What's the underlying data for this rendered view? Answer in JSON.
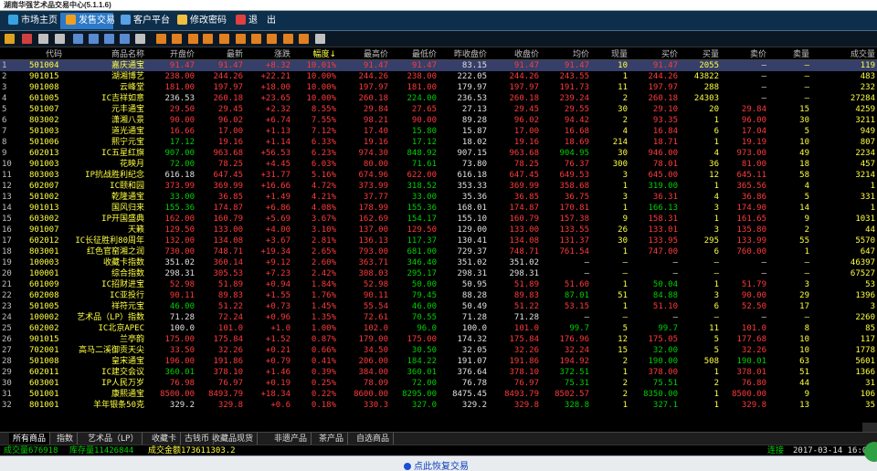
{
  "title": "湖南华强艺术品交易中心(5.1.1.6)",
  "menu": [
    {
      "label": "市场主页",
      "icon": "home-icon"
    },
    {
      "label": "发售交易",
      "icon": "trade-icon"
    },
    {
      "label": "客户平台",
      "icon": "user-icon"
    },
    {
      "label": "修改密码",
      "icon": "key-icon"
    },
    {
      "label": "退",
      "icon": "exit-icon"
    },
    {
      "label": "出",
      "icon": ""
    }
  ],
  "headers": [
    "",
    "代码",
    "商品名称",
    "开盘价",
    "最新",
    "涨跌",
    "幅度↓",
    "最高价",
    "最低价",
    "昨收盘价",
    "收盘价",
    "均价",
    "现量",
    "买价",
    "买量",
    "卖价",
    "卖量",
    "成交量"
  ],
  "rows": [
    [
      "1",
      "501004",
      "嘉庆通宝",
      "91.47",
      "91.47",
      "+8.32",
      "10.01%",
      "91.47",
      "91.47",
      "83.15",
      "91.47",
      "91.47",
      "10",
      "91.47",
      "2055",
      "—",
      "—",
      "119"
    ],
    [
      "2",
      "901015",
      "湖湘博艺",
      "238.00",
      "244.26",
      "+22.21",
      "10.00%",
      "244.26",
      "238.00",
      "222.05",
      "244.26",
      "243.55",
      "1",
      "244.26",
      "43822",
      "—",
      "—",
      "483"
    ],
    [
      "3",
      "901008",
      "云峰堂",
      "181.00",
      "197.97",
      "+18.00",
      "10.00%",
      "197.97",
      "181.00",
      "179.97",
      "197.97",
      "191.73",
      "11",
      "197.97",
      "288",
      "—",
      "—",
      "232"
    ],
    [
      "4",
      "601005",
      "IC吉祥如意",
      "236.53",
      "260.18",
      "+23.65",
      "10.00%",
      "260.18",
      "224.00",
      "236.53",
      "260.18",
      "239.24",
      "2",
      "260.18",
      "24303",
      "—",
      "—",
      "27284"
    ],
    [
      "5",
      "501007",
      "元丰通宝",
      "29.50",
      "29.45",
      "+2.32",
      "8.55%",
      "29.84",
      "27.65",
      "27.13",
      "29.45",
      "29.55",
      "30",
      "29.10",
      "20",
      "29.84",
      "15",
      "4259"
    ],
    [
      "6",
      "803002",
      "潇湘八景",
      "90.00",
      "96.02",
      "+6.74",
      "7.55%",
      "98.21",
      "90.00",
      "89.28",
      "96.02",
      "94.42",
      "2",
      "93.35",
      "1",
      "96.00",
      "30",
      "3211"
    ],
    [
      "7",
      "501003",
      "道光通宝",
      "16.66",
      "17.00",
      "+1.13",
      "7.12%",
      "17.40",
      "15.80",
      "15.87",
      "17.00",
      "16.68",
      "4",
      "16.84",
      "6",
      "17.04",
      "5",
      "949"
    ],
    [
      "8",
      "501006",
      "熙宁元宝",
      "17.12",
      "19.16",
      "+1.14",
      "6.33%",
      "19.16",
      "17.12",
      "18.02",
      "19.16",
      "18.69",
      "214",
      "18.71",
      "1",
      "19.19",
      "10",
      "807"
    ],
    [
      "9",
      "602013",
      "IC五星红旗",
      "907.00",
      "963.68",
      "+56.53",
      "6.23%",
      "974.30",
      "848.92",
      "907.15",
      "963.68",
      "904.95",
      "30",
      "946.00",
      "4",
      "973.00",
      "49",
      "2234"
    ],
    [
      "10",
      "901003",
      "花映月",
      "72.00",
      "78.25",
      "+4.45",
      "6.03%",
      "80.00",
      "71.61",
      "73.80",
      "78.25",
      "76.37",
      "300",
      "78.01",
      "36",
      "81.00",
      "18",
      "457"
    ],
    [
      "11",
      "803003",
      "IP抗战胜利纪念",
      "616.18",
      "647.45",
      "+31.77",
      "5.16%",
      "674.96",
      "622.00",
      "616.18",
      "647.45",
      "649.53",
      "3",
      "645.00",
      "12",
      "645.11",
      "58",
      "3214"
    ],
    [
      "12",
      "602007",
      "IC颐和园",
      "373.99",
      "369.99",
      "+16.66",
      "4.72%",
      "373.99",
      "318.52",
      "353.33",
      "369.99",
      "358.68",
      "1",
      "319.00",
      "1",
      "365.56",
      "4",
      "1"
    ],
    [
      "13",
      "501002",
      "乾隆通宝",
      "33.00",
      "36.85",
      "+1.49",
      "4.21%",
      "37.77",
      "33.00",
      "35.36",
      "36.85",
      "36.75",
      "3",
      "36.31",
      "4",
      "36.86",
      "5",
      "331"
    ],
    [
      "14",
      "901013",
      "国风归来",
      "155.36",
      "174.87",
      "+6.86",
      "4.08%",
      "178.99",
      "155.36",
      "168.01",
      "174.87",
      "170.81",
      "1",
      "166.13",
      "3",
      "174.90",
      "14",
      "1"
    ],
    [
      "15",
      "603002",
      "IP开国盛典",
      "162.00",
      "160.79",
      "+5.69",
      "3.67%",
      "162.69",
      "154.17",
      "155.10",
      "160.79",
      "157.38",
      "9",
      "158.31",
      "1",
      "161.65",
      "9",
      "1031"
    ],
    [
      "16",
      "901007",
      "天籁",
      "129.50",
      "133.00",
      "+4.00",
      "3.10%",
      "137.00",
      "129.50",
      "129.00",
      "133.00",
      "133.55",
      "26",
      "133.01",
      "3",
      "135.80",
      "2",
      "44"
    ],
    [
      "17",
      "602012",
      "IC长征胜利80周年",
      "132.00",
      "134.08",
      "+3.67",
      "2.81%",
      "136.13",
      "117.37",
      "130.41",
      "134.08",
      "131.37",
      "30",
      "133.95",
      "295",
      "133.99",
      "55",
      "5570"
    ],
    [
      "18",
      "803001",
      "红色官窑湘之润",
      "730.00",
      "748.71",
      "+19.34",
      "2.65%",
      "793.00",
      "681.00",
      "729.37",
      "748.71",
      "761.54",
      "1",
      "747.00",
      "6",
      "760.00",
      "1",
      "647"
    ],
    [
      "19",
      "100003",
      "收藏卡指数",
      "351.02",
      "360.14",
      "+9.12",
      "2.60%",
      "363.71",
      "346.40",
      "351.02",
      "351.02",
      "—",
      "—",
      "—",
      "—",
      "—",
      "—",
      "46397"
    ],
    [
      "20",
      "100001",
      "综合指数",
      "298.31",
      "305.53",
      "+7.23",
      "2.42%",
      "308.03",
      "295.17",
      "298.31",
      "298.31",
      "—",
      "—",
      "—",
      "—",
      "—",
      "—",
      "67527"
    ],
    [
      "21",
      "601009",
      "IC招财进宝",
      "52.98",
      "51.89",
      "+0.94",
      "1.84%",
      "52.98",
      "50.00",
      "50.95",
      "51.89",
      "51.60",
      "1",
      "50.04",
      "1",
      "51.79",
      "3",
      "53"
    ],
    [
      "22",
      "602008",
      "IC亚投行",
      "90.11",
      "89.83",
      "+1.55",
      "1.76%",
      "90.11",
      "79.45",
      "88.28",
      "89.83",
      "87.01",
      "51",
      "84.88",
      "3",
      "90.00",
      "29",
      "1396"
    ],
    [
      "23",
      "501005",
      "祥符元宝",
      "46.00",
      "51.22",
      "+0.73",
      "1.45%",
      "55.54",
      "46.00",
      "50.49",
      "51.22",
      "53.15",
      "1",
      "51.10",
      "6",
      "52.50",
      "17",
      "3"
    ],
    [
      "24",
      "100002",
      "艺术品（LP）指数",
      "71.28",
      "72.24",
      "+0.96",
      "1.35%",
      "72.61",
      "70.55",
      "71.28",
      "71.28",
      "—",
      "—",
      "—",
      "—",
      "—",
      "—",
      "2260"
    ],
    [
      "25",
      "602002",
      "IC北京APEC",
      "100.0",
      "101.0",
      "+1.0",
      "1.00%",
      "102.0",
      "96.0",
      "100.0",
      "101.0",
      "99.7",
      "5",
      "99.7",
      "11",
      "101.0",
      "8",
      "85"
    ],
    [
      "26",
      "901015",
      "兰亭韵",
      "175.00",
      "175.84",
      "+1.52",
      "0.87%",
      "179.00",
      "175.00",
      "174.32",
      "175.84",
      "176.96",
      "12",
      "175.05",
      "5",
      "177.68",
      "10",
      "117"
    ],
    [
      "27",
      "702001",
      "高马二溪御贡天尖",
      "33.50",
      "32.26",
      "+0.21",
      "0.66%",
      "34.50",
      "30.50",
      "32.05",
      "32.26",
      "32.24",
      "15",
      "32.00",
      "5",
      "32.26",
      "10",
      "1778"
    ],
    [
      "28",
      "501008",
      "皇宋通宝",
      "196.00",
      "191.86",
      "+0.79",
      "0.41%",
      "206.00",
      "184.22",
      "191.07",
      "191.86",
      "194.92",
      "2",
      "190.00",
      "508",
      "190.01",
      "63",
      "5601"
    ],
    [
      "29",
      "602011",
      "IC建交会议",
      "360.01",
      "378.10",
      "+1.46",
      "0.39%",
      "384.00",
      "360.01",
      "376.64",
      "378.10",
      "372.51",
      "1",
      "378.00",
      "1",
      "378.01",
      "51",
      "1366"
    ],
    [
      "30",
      "603001",
      "IP人民万岁",
      "76.98",
      "76.97",
      "+0.19",
      "0.25%",
      "78.09",
      "72.00",
      "76.78",
      "76.97",
      "75.31",
      "2",
      "75.51",
      "2",
      "76.80",
      "44",
      "31"
    ],
    [
      "31",
      "501001",
      "康熙通宝",
      "8500.00",
      "8493.79",
      "+18.34",
      "0.22%",
      "8600.00",
      "8295.00",
      "8475.45",
      "8493.79",
      "8502.57",
      "2",
      "8350.00",
      "1",
      "8500.00",
      "9",
      "106"
    ],
    [
      "32",
      "801001",
      "羊年银条50克",
      "329.2",
      "329.8",
      "+0.6",
      "0.18%",
      "330.3",
      "327.0",
      "329.2",
      "329.8",
      "328.8",
      "1",
      "327.1",
      "1",
      "329.8",
      "13",
      "35"
    ]
  ],
  "tabs": [
    "所有商品",
    "指数",
    "艺术品（LP）",
    "收藏卡",
    "古钱币",
    "收藏品现货",
    "非遗产品",
    "茶产品",
    "自选商品"
  ],
  "status": {
    "volume": "成交量676918",
    "inventory": "库存量11426844",
    "amount": "成交金额173611303.2",
    "connection": "连接",
    "datetime": "2017-03-14 16:00"
  },
  "bottom": {
    "restore": "点此恢复交易"
  },
  "colors": {
    "up": "#ff3a3a",
    "down": "#00d000",
    "code": "#ffff40",
    "menubar": "#0d2f4c",
    "active_tab": "#2c79c7"
  }
}
